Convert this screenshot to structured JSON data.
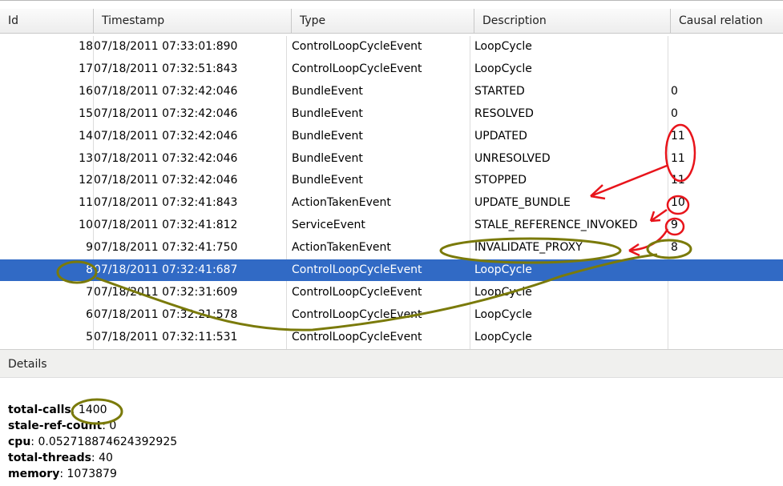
{
  "columns": [
    "Id",
    "Timestamp",
    "Type",
    "Description",
    "Causal relation"
  ],
  "rows": [
    {
      "id": "18",
      "ts": "07/18/2011 07:33:01:890",
      "type": "ControlLoopCycleEvent",
      "desc": "LoopCycle",
      "causal": ""
    },
    {
      "id": "17",
      "ts": "07/18/2011 07:32:51:843",
      "type": "ControlLoopCycleEvent",
      "desc": "LoopCycle",
      "causal": ""
    },
    {
      "id": "16",
      "ts": "07/18/2011 07:32:42:046",
      "type": "BundleEvent",
      "desc": "STARTED",
      "causal": "0"
    },
    {
      "id": "15",
      "ts": "07/18/2011 07:32:42:046",
      "type": "BundleEvent",
      "desc": "RESOLVED",
      "causal": "0"
    },
    {
      "id": "14",
      "ts": "07/18/2011 07:32:42:046",
      "type": "BundleEvent",
      "desc": "UPDATED",
      "causal": "11"
    },
    {
      "id": "13",
      "ts": "07/18/2011 07:32:42:046",
      "type": "BundleEvent",
      "desc": "UNRESOLVED",
      "causal": "11"
    },
    {
      "id": "12",
      "ts": "07/18/2011 07:32:42:046",
      "type": "BundleEvent",
      "desc": "STOPPED",
      "causal": "11"
    },
    {
      "id": "11",
      "ts": "07/18/2011 07:32:41:843",
      "type": "ActionTakenEvent",
      "desc": "UPDATE_BUNDLE",
      "causal": "10"
    },
    {
      "id": "10",
      "ts": "07/18/2011 07:32:41:812",
      "type": "ServiceEvent",
      "desc": "STALE_REFERENCE_INVOKED",
      "causal": "9"
    },
    {
      "id": "9",
      "ts": "07/18/2011 07:32:41:750",
      "type": "ActionTakenEvent",
      "desc": "INVALIDATE_PROXY",
      "causal": "8"
    },
    {
      "id": "8",
      "ts": "07/18/2011 07:32:41:687",
      "type": "ControlLoopCycleEvent",
      "desc": "LoopCycle",
      "causal": ""
    },
    {
      "id": "7",
      "ts": "07/18/2011 07:32:31:609",
      "type": "ControlLoopCycleEvent",
      "desc": "LoopCycle",
      "causal": ""
    },
    {
      "id": "6",
      "ts": "07/18/2011 07:32:21:578",
      "type": "ControlLoopCycleEvent",
      "desc": "LoopCycle",
      "causal": ""
    },
    {
      "id": "5",
      "ts": "07/18/2011 07:32:11:531",
      "type": "ControlLoopCycleEvent",
      "desc": "LoopCycle",
      "causal": ""
    }
  ],
  "selected_row_id": "8",
  "details": {
    "title": "Details",
    "lines": [
      {
        "key": "total-calls",
        "sep": ": ",
        "value": "1400"
      },
      {
        "key": "stale-ref-count",
        "sep": ": ",
        "value": "0"
      },
      {
        "key": "cpu",
        "sep": ": ",
        "value": "0.052718874624392925"
      },
      {
        "key": "total-threads",
        "sep": ": ",
        "value": "40"
      },
      {
        "key": "memory",
        "sep": ": ",
        "value": "1073879"
      }
    ]
  },
  "colors": {
    "selection": "#316ac5",
    "annotation_red": "#e8141b",
    "annotation_olive": "#7a7a0a"
  }
}
